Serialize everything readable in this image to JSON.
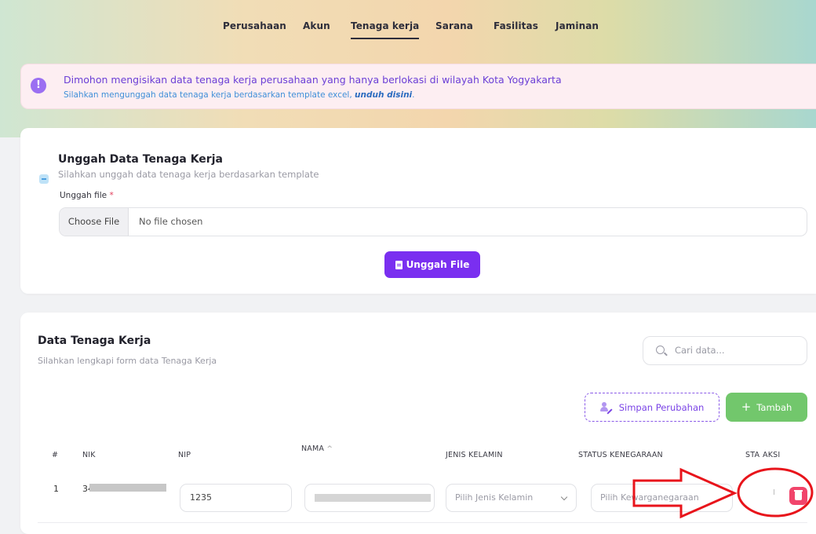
{
  "nav": {
    "tabs": [
      {
        "label": "Perusahaan"
      },
      {
        "label": "Akun"
      },
      {
        "label": "Tenaga kerja"
      },
      {
        "label": "Sarana"
      },
      {
        "label": "Fasilitas"
      },
      {
        "label": "Jaminan"
      }
    ],
    "active_tab": "Tenaga kerja"
  },
  "alert": {
    "icon": "info-icon",
    "line1": "Dimohon mengisikan data tenaga kerja perusahaan yang hanya berlokasi di wilayah Kota Yogyakarta",
    "line2_text": "Silahkan mengunggah data tenaga kerja berdasarkan template excel,",
    "line2_link": "unduh disini",
    "line2_end": "."
  },
  "upload": {
    "title": "Unggah Data Tenaga Kerja",
    "subtitle": "Silahkan unggah data tenaga kerja berdasarkan template",
    "field_label": "Unggah file",
    "required_mark": "*",
    "choose_button": "Choose File",
    "no_file_text": "No file chosen",
    "submit_label": "Unggah File"
  },
  "data": {
    "title": "Data Tenaga Kerja",
    "subtitle": "Silahkan lengkapi form data Tenaga Kerja",
    "search_placeholder": "Cari data...",
    "save_label": "Simpan Perubahan",
    "add_label": "Tambah",
    "columns": {
      "no": "#",
      "nik": "NIK",
      "nip": "NIP",
      "nama": "NAMA",
      "sort_icon": "^",
      "jenis_kelamin": "JENIS KELAMIN",
      "status_kenegaraan": "STATUS KENEGARAAN",
      "status": "STA",
      "aksi": "AKSI"
    },
    "rows": [
      {
        "no": "1",
        "nik_visible": "34",
        "nip": "1235",
        "jenis_kelamin_placeholder": "Pilih Jenis Kelamin",
        "kewarganegaraan_placeholder": "Pilih Kewarganegaraan",
        "status_visible": "I"
      }
    ]
  },
  "colors": {
    "accent_purple": "#7a2ff0",
    "success_green": "#72c76c",
    "danger_red": "#f1456b",
    "annotation_red": "#e8141b"
  }
}
